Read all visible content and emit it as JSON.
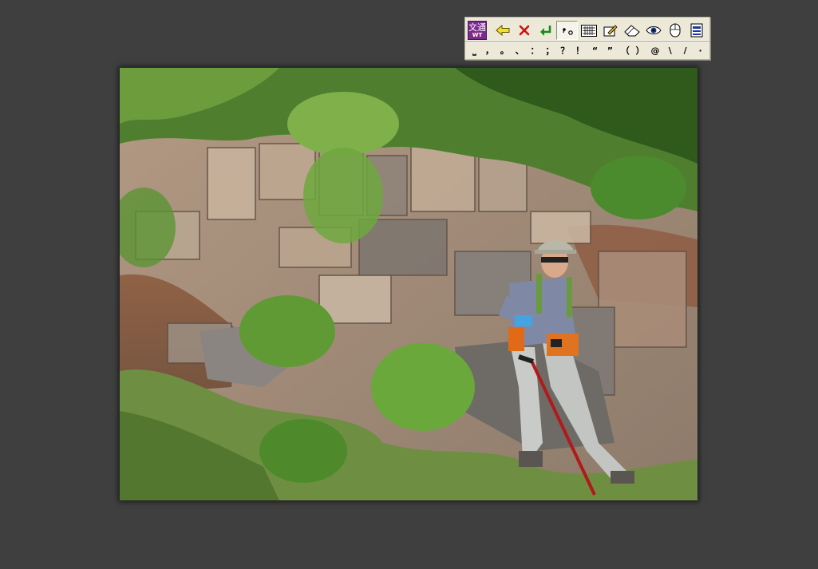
{
  "ime_toolbar": {
    "logo_line1": "文通",
    "logo_line2": "WT",
    "buttons": [
      {
        "name": "back-arrow-icon",
        "color": "#e0c000"
      },
      {
        "name": "close-icon",
        "color": "#d01010"
      },
      {
        "name": "enter-icon",
        "color": "#1a8a1a"
      },
      {
        "name": "punctuation-mode-icon",
        "label": "•。"
      },
      {
        "name": "keyboard-icon"
      },
      {
        "name": "edit-icon"
      },
      {
        "name": "eraser-icon"
      },
      {
        "name": "eye-icon"
      },
      {
        "name": "mouse-icon"
      },
      {
        "name": "document-icon"
      }
    ],
    "punctuation": [
      "⎵",
      "，",
      "。",
      "、",
      "：",
      "；",
      "？",
      "！",
      "“",
      "”",
      "（",
      "）",
      "@",
      "\\",
      "/",
      "·"
    ]
  },
  "colors": {
    "background": "#3f3f3f",
    "toolbar_bg": "#ece9d8",
    "logo_bg": "#7b2a8e"
  }
}
